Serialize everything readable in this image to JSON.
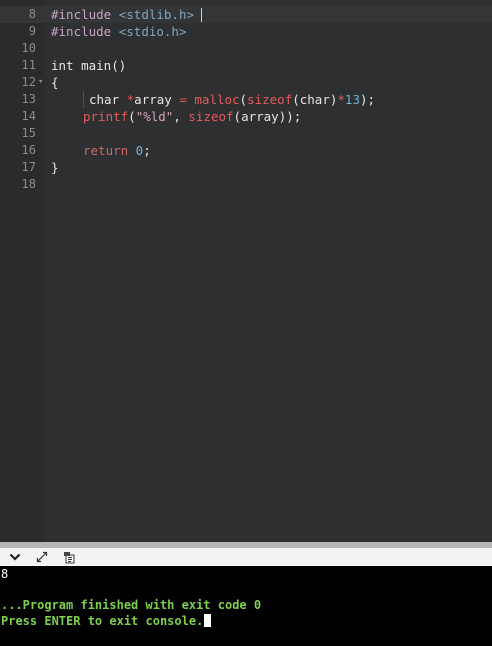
{
  "editor": {
    "lines": [
      {
        "n": "8",
        "fold": ""
      },
      {
        "n": "9",
        "fold": ""
      },
      {
        "n": "10",
        "fold": ""
      },
      {
        "n": "11",
        "fold": ""
      },
      {
        "n": "12",
        "fold": "▾"
      },
      {
        "n": "13",
        "fold": ""
      },
      {
        "n": "14",
        "fold": ""
      },
      {
        "n": "15",
        "fold": ""
      },
      {
        "n": "16",
        "fold": ""
      },
      {
        "n": "17",
        "fold": ""
      },
      {
        "n": "18",
        "fold": ""
      }
    ],
    "tokens": {
      "l8_pre": "#include",
      "l8_inc": "<stdlib.h>",
      "l9_pre": "#include",
      "l9_inc": "<stdio.h>",
      "l11_kw": "int",
      "l11_name": " main()",
      "l12_brace": "{",
      "l13_type": "char",
      "l13_star": " *",
      "l13_var": "array",
      "l13_eq": " = ",
      "l13_fn": "malloc",
      "l13_p1": "(",
      "l13_sizeof": "sizeof",
      "l13_p2": "(char)",
      "l13_mul": "*",
      "l13_num": "13",
      "l13_end": ");",
      "l14_fn": "printf",
      "l14_p1": "(",
      "l14_str": "\"%ld\"",
      "l14_comma": ", ",
      "l14_sizeof": "sizeof",
      "l14_end": "(array));",
      "l16_ret": "return",
      "l16_num": " 0",
      "l16_semi": ";",
      "l17_brace": "}"
    }
  },
  "toolbar": {
    "collapse_icon": "chevron-down-icon",
    "expand_icon": "expand-icon",
    "copy_icon": "copy-icon"
  },
  "console": {
    "output": "8",
    "finish_message": "...Program finished with exit code 0",
    "enter_message": "Press ENTER to exit console."
  },
  "colors": {
    "editor_bg": "#2e2f30",
    "console_bg": "#000000",
    "console_text": "#7dd04a"
  }
}
